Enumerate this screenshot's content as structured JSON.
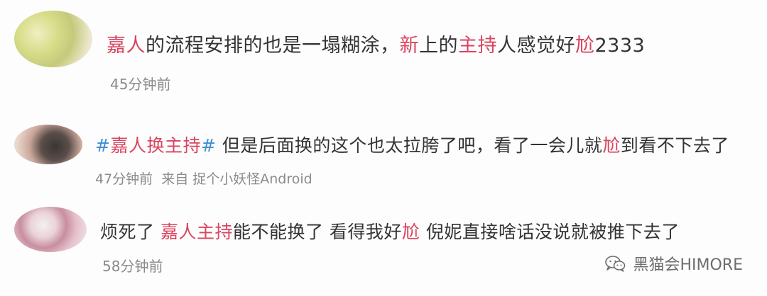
{
  "comments": [
    {
      "segments": [
        {
          "text": "嘉人",
          "style": "pink"
        },
        {
          "text": "的流程安排的也是一塌糊涂，",
          "style": "normal"
        },
        {
          "text": "新",
          "style": "pink"
        },
        {
          "text": "上的",
          "style": "normal"
        },
        {
          "text": "主持",
          "style": "pink"
        },
        {
          "text": "人感觉好",
          "style": "normal"
        },
        {
          "text": "尬",
          "style": "pink"
        },
        {
          "text": "2333",
          "style": "normal"
        }
      ],
      "time": "45分钟前",
      "source": ""
    },
    {
      "segments": [
        {
          "text": "#",
          "style": "blue"
        },
        {
          "text": "嘉人换主持",
          "style": "pink"
        },
        {
          "text": "#",
          "style": "blue"
        },
        {
          "text": " 但是后面换的这个也太拉胯了吧，看了一会儿就",
          "style": "normal"
        },
        {
          "text": "尬",
          "style": "pink"
        },
        {
          "text": "到看不下去了",
          "style": "normal"
        }
      ],
      "time": "47分钟前",
      "source": "来自 捉个小妖怪Android"
    },
    {
      "segments": [
        {
          "text": "烦死了 ",
          "style": "normal"
        },
        {
          "text": "嘉人主持",
          "style": "pink"
        },
        {
          "text": "能不能换了 看得我好",
          "style": "normal"
        },
        {
          "text": "尬",
          "style": "pink"
        },
        {
          "text": " 倪妮直接啥话没说就被推下去了",
          "style": "normal"
        }
      ],
      "time": "58分钟前",
      "source": ""
    }
  ],
  "watermark": {
    "icon": "wechat-icon",
    "text": "黑猫会HIMORE"
  },
  "colors": {
    "highlight": "#d9445f",
    "hashtag": "#3f8ed4",
    "text": "#333333",
    "meta": "#8a8a8a"
  }
}
